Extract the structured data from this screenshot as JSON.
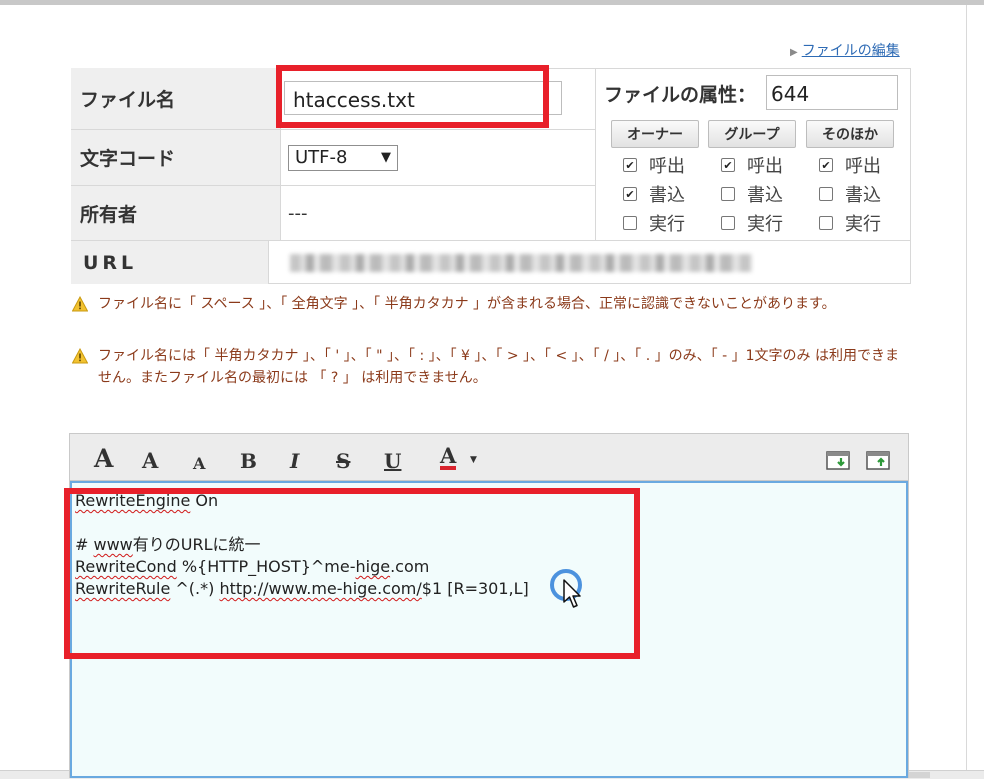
{
  "edit_link": "ファイルの編集",
  "file": {
    "name_label": "ファイル名",
    "name_value": "htaccess.txt",
    "encoding_label": "文字コード",
    "encoding_value": "UTF-8",
    "owner_label": "所有者",
    "owner_value": "---",
    "url_label": "URL"
  },
  "attributes": {
    "label": "ファイルの属性：",
    "value": "644",
    "groups": [
      "オーナー",
      "グループ",
      "そのほか"
    ],
    "perm_labels": [
      "呼出",
      "書込",
      "実行"
    ],
    "checked": {
      "owner": [
        true,
        true,
        false
      ],
      "group": [
        true,
        false,
        false
      ],
      "other": [
        true,
        false,
        false
      ]
    }
  },
  "warnings": [
    "ファイル名に「 スペース 」、「 全角文字 」、「 半角カタカナ 」が含まれる場合、正常に認識できないことがあります。",
    "ファイル名には「 半角カタカナ 」、「 ' 」、「 \" 」、「 : 」、「 ¥ 」、「 > 」、「 < 」、「 / 」、「 . 」のみ、「 - 」1文字のみ は利用できません。またファイル名の最初には 「 ? 」 は利用できません。"
  ],
  "toolbar": {
    "font_large": "A",
    "font_medium": "A",
    "font_small": "A",
    "bold": "B",
    "italic": "I",
    "strike": "S",
    "underline": "U",
    "color": "A"
  },
  "editor": {
    "line1_a": "RewriteEngine",
    "line1_b": " On",
    "line3_a": "# ",
    "line3_b": "www",
    "line3_c": "有りのURLに統一",
    "line4_a": "RewriteCond",
    "line4_b": " %{HTTP_HOST}^me-",
    "line4_c": "hige",
    "line4_d": ".com",
    "line5_a": "RewriteRule",
    "line5_b": " ^(.*) ",
    "line5_c": "http://www.me-hige.com/",
    "line5_d": "$1 [R=301,L]"
  },
  "colors": {
    "highlight": "#e8202a",
    "link": "#2e6bb5",
    "editor_bg": "#f2fcfc",
    "editor_border": "#6aa9e0"
  }
}
